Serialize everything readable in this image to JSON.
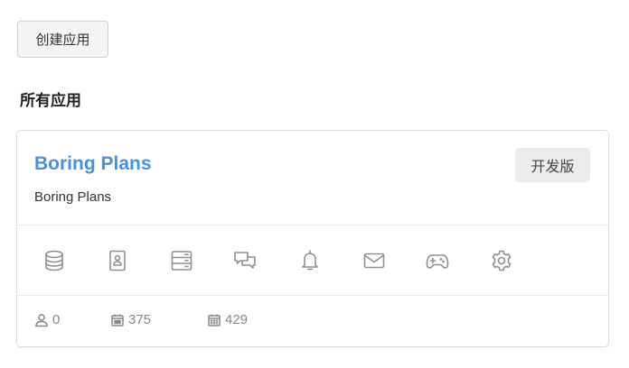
{
  "toolbar": {
    "create_label": "创建应用"
  },
  "section": {
    "title": "所有应用"
  },
  "app": {
    "name": "Boring Plans",
    "description": "Boring Plans",
    "env_badge": "开发版",
    "actions": [
      {
        "name": "database-icon"
      },
      {
        "name": "contact-card-icon"
      },
      {
        "name": "server-icon"
      },
      {
        "name": "chat-icon"
      },
      {
        "name": "bell-icon"
      },
      {
        "name": "mail-icon"
      },
      {
        "name": "gamepad-icon"
      },
      {
        "name": "gear-icon"
      }
    ],
    "stats": {
      "users": "0",
      "calendar_a": "375",
      "calendar_b": "429"
    }
  },
  "colors": {
    "accent": "#4a90d9",
    "icon": "#8f8f8f",
    "badge_bg": "#ececec"
  }
}
